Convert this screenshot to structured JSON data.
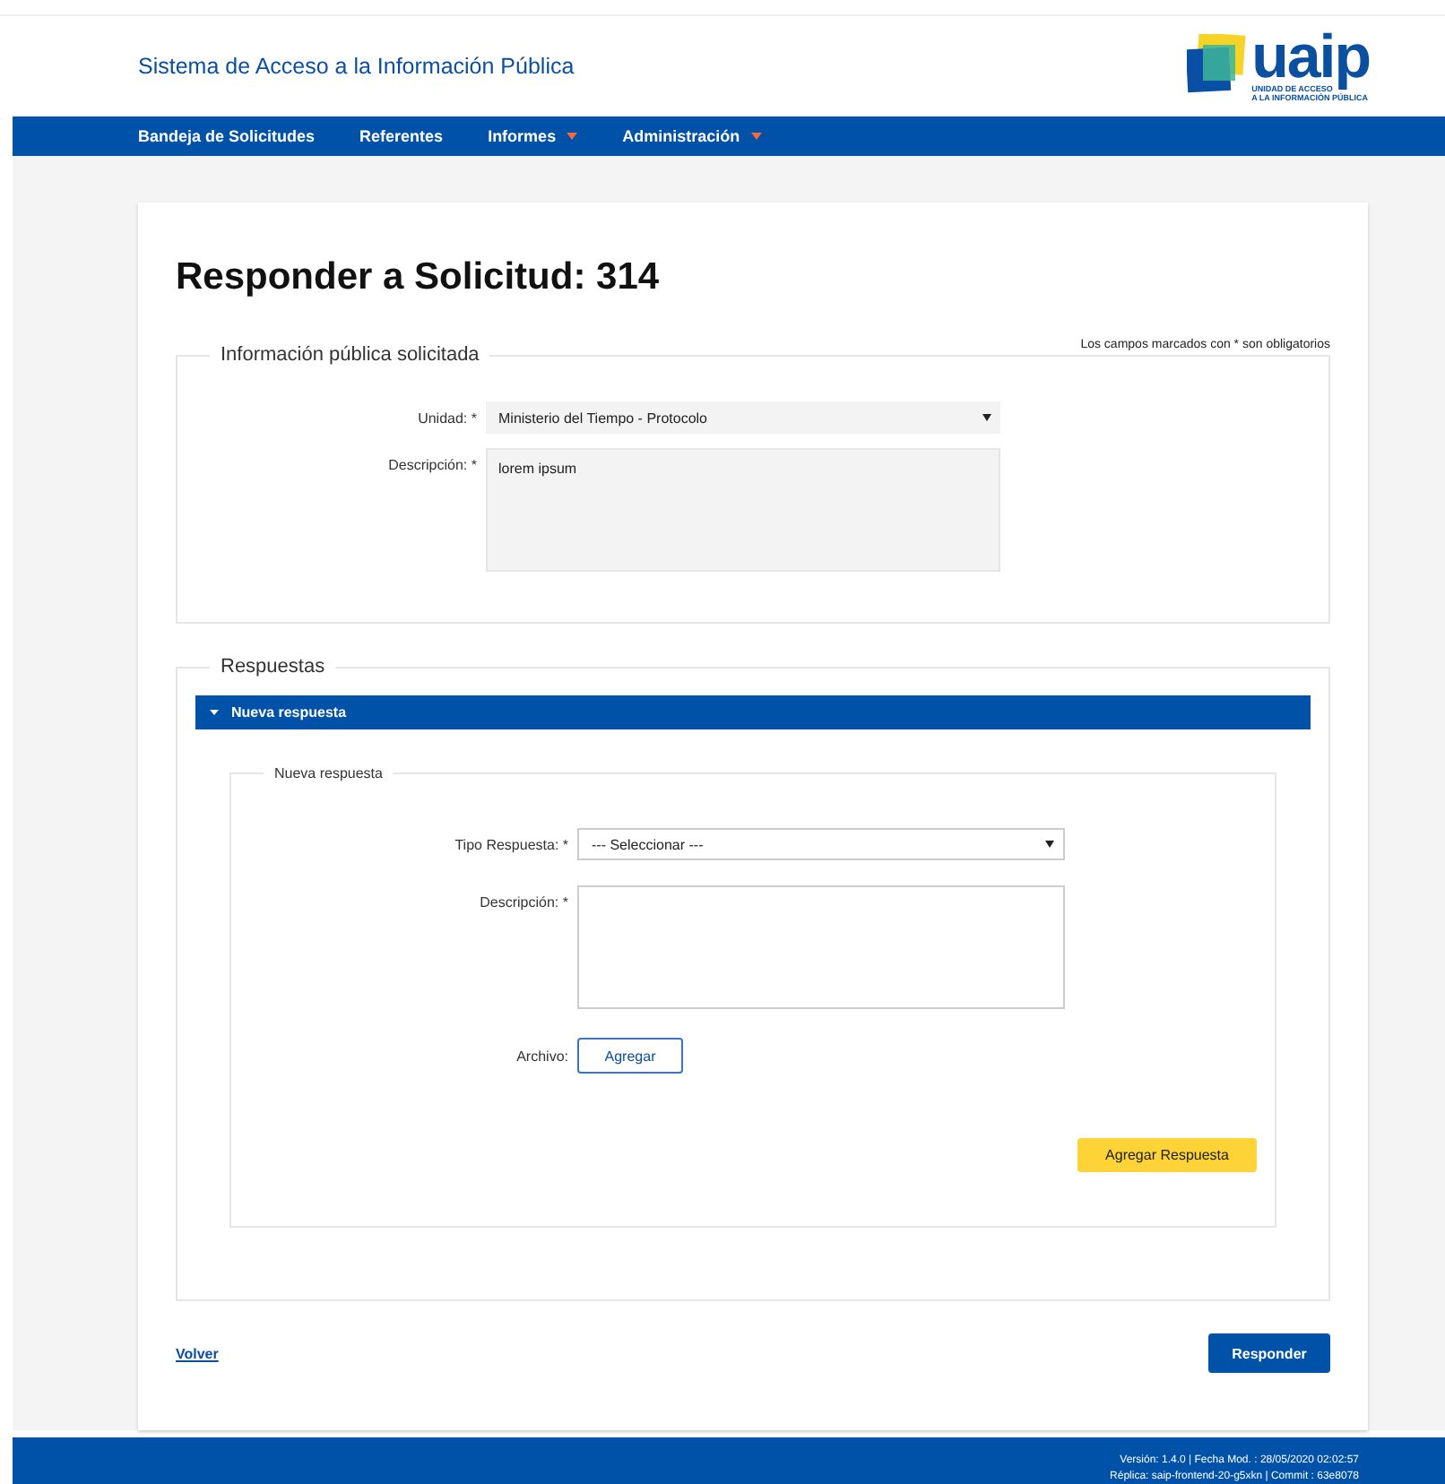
{
  "header": {
    "title": "Sistema de Acceso a la Información Pública",
    "logo_text": "uaip",
    "logo_subtitle": [
      "UNIDAD DE ACCESO",
      "A LA INFORMACIÓN PÚBLICA"
    ]
  },
  "nav": [
    {
      "label": "Bandeja de Solicitudes",
      "dropdown": false
    },
    {
      "label": "Referentes",
      "dropdown": false
    },
    {
      "label": "Informes",
      "dropdown": true
    },
    {
      "label": "Administración",
      "dropdown": true
    }
  ],
  "page_title": "Responder a Solicitud: 314",
  "required_note": "Los campos marcados con * son obligatorios",
  "info_section": {
    "legend": "Información pública solicitada",
    "unidad_label": "Unidad: *",
    "unidad_value": "Ministerio del Tiempo - Protocolo",
    "descripcion_label": "Descripción: *",
    "descripcion_value": "lorem ipsum"
  },
  "responses_section": {
    "legend": "Respuestas",
    "panel_title": "Nueva respuesta",
    "expanded": true,
    "inner_legend": "Nueva respuesta",
    "tipo_label": "Tipo Respuesta: *",
    "tipo_value": "--- Seleccionar ---",
    "descripcion_label": "Descripción: *",
    "archivo_label": "Archivo:",
    "archivo_button": "Agregar",
    "submit_button": "Agregar Respuesta"
  },
  "back_link": "Volver",
  "respond_button": "Responder",
  "footer": [
    "Versión: 1.4.0 | Fecha Mod. : 28/05/2020 02:02:57",
    "Réplica: saip-frontend-20-g5xkn | Commit : 63e8078"
  ]
}
